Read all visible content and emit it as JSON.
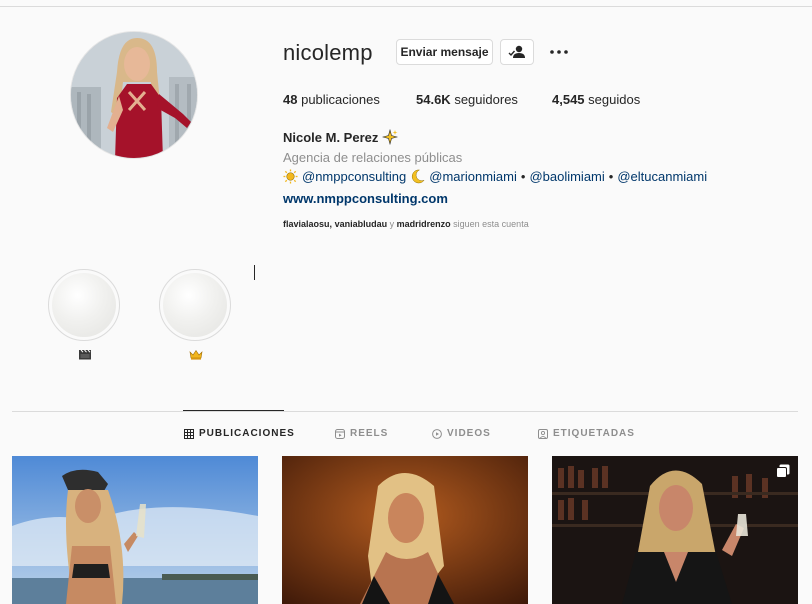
{
  "profile": {
    "username": "nicolemp",
    "message_button": "Enviar mensaje",
    "full_name": "Nicole M. Perez",
    "category": "Agencia de relaciones públicas",
    "mentions": [
      "@nmppconsulting",
      "@marionmiami",
      "@baolimiami",
      "@eltucanmiami"
    ],
    "mention_separator": "•",
    "website": "www.nmppconsulting.com",
    "followed_by": {
      "users": [
        "flavialaosu",
        "vaniabludau",
        "madridrenzo"
      ],
      "comma": ",",
      "conjunction": "y",
      "suffix": "siguen esta cuenta"
    }
  },
  "stats": {
    "posts": {
      "value": "48",
      "label": "publicaciones"
    },
    "followers": {
      "value": "54.6K",
      "label": "seguidores"
    },
    "following": {
      "value": "4,545",
      "label": "seguidos"
    }
  },
  "highlights": [
    {
      "icon": "clapperboard-emoji-icon"
    },
    {
      "icon": "crown-emoji-icon"
    }
  ],
  "tabs": [
    {
      "label": "PUBLICACIONES",
      "icon": "grid-icon",
      "active": true
    },
    {
      "label": "REELS",
      "icon": "reels-icon",
      "active": false
    },
    {
      "label": "VIDEOS",
      "icon": "play-circle-icon",
      "active": false
    },
    {
      "label": "ETIQUETADAS",
      "icon": "tagged-icon",
      "active": false
    }
  ],
  "posts": [
    {
      "type": "image"
    },
    {
      "type": "image"
    },
    {
      "type": "carousel"
    }
  ],
  "colors": {
    "text": "#262626",
    "muted": "#8e8e8e",
    "link": "#00376b",
    "border": "#dbdbdb",
    "background": "#fafafa"
  }
}
